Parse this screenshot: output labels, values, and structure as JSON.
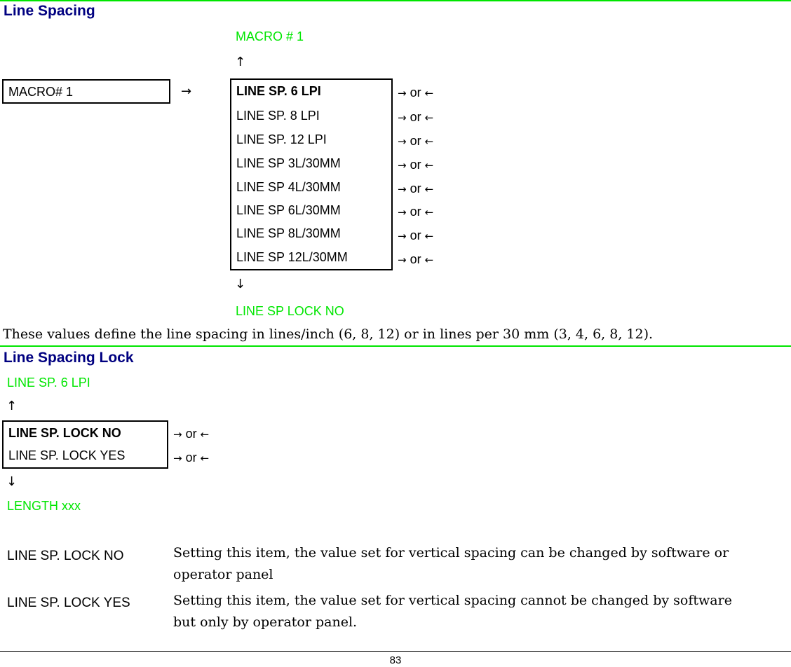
{
  "section1": {
    "heading": "Line Spacing",
    "prev_item": "MACRO # 1",
    "up_arrow": "↑",
    "source_box_label": "MACRO# 1",
    "right_arrow": "→",
    "options": [
      {
        "label": "LINE SP. 6 LPI",
        "selected": true
      },
      {
        "label": "LINE SP. 8 LPI",
        "selected": false
      },
      {
        "label": "LINE SP. 12 LPI",
        "selected": false
      },
      {
        "label": "LINE SP 3L/30MM",
        "selected": false
      },
      {
        "label": "LINE SP 4L/30MM",
        "selected": false
      },
      {
        "label": "LINE SP 6L/30MM",
        "selected": false
      },
      {
        "label": "LINE SP 8L/30MM",
        "selected": false
      },
      {
        "label": "LINE SP 12L/30MM",
        "selected": false
      }
    ],
    "nav_hint": {
      "right": "→",
      "or": "or",
      "left": "←"
    },
    "down_arrow": "↓",
    "next_item": "LINE SP LOCK NO",
    "description": "These values define the line spacing in lines/inch (6, 8, 12) or in lines per 30 mm  (3, 4, 6, 8, 12)."
  },
  "section2": {
    "heading": "Line Spacing Lock",
    "prev_item": "LINE SP. 6 LPI",
    "up_arrow": "↑",
    "options": [
      {
        "label": "LINE SP. LOCK NO",
        "selected": true
      },
      {
        "label": "LINE SP. LOCK YES",
        "selected": false
      }
    ],
    "nav_hint": {
      "right": "→",
      "or": "or",
      "left": "←"
    },
    "down_arrow": "↓",
    "next_item": "LENGTH xxx",
    "definitions": [
      {
        "term": "LINE SP. LOCK NO",
        "text": "Setting this item, the value set for vertical spacing can be changed by software or operator panel"
      },
      {
        "term": "LINE SP. LOCK YES",
        "text": "Setting this item, the value set for vertical spacing cannot be changed by software but only by operator panel."
      }
    ]
  },
  "footer": {
    "page_number": "83"
  },
  "colors": {
    "heading": "#000080",
    "menu_neighbor": "#00e600",
    "rule": "#00e600"
  }
}
